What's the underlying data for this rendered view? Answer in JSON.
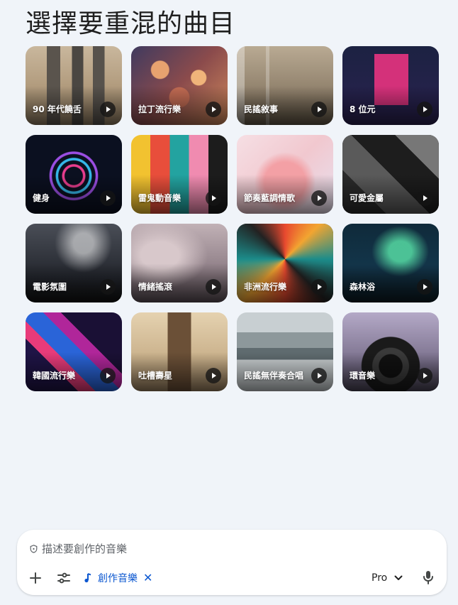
{
  "page": {
    "title": "選擇要重混的曲目"
  },
  "tiles": [
    {
      "label": "90 年代饒舌",
      "bg": "bg-0"
    },
    {
      "label": "拉丁流行樂",
      "bg": "bg-1"
    },
    {
      "label": "民謠敘事",
      "bg": "bg-2"
    },
    {
      "label": "8 位元",
      "bg": "bg-3"
    },
    {
      "label": "健身",
      "bg": "bg-4"
    },
    {
      "label": "雷鬼動音樂",
      "bg": "bg-5"
    },
    {
      "label": "節奏藍調情歌",
      "bg": "bg-6"
    },
    {
      "label": "可愛金屬",
      "bg": "bg-7"
    },
    {
      "label": "電影氛圍",
      "bg": "bg-8"
    },
    {
      "label": "情緒搖滾",
      "bg": "bg-9"
    },
    {
      "label": "非洲流行樂",
      "bg": "bg-10"
    },
    {
      "label": "森林浴",
      "bg": "bg-11"
    },
    {
      "label": "韓國流行樂",
      "bg": "bg-12"
    },
    {
      "label": "吐槽壽星",
      "bg": "bg-13"
    },
    {
      "label": "民謠無伴奏合唱",
      "bg": "bg-14"
    },
    {
      "label": "環音樂",
      "bg": "bg-15"
    }
  ],
  "composer": {
    "placeholder": "描述要創作的音樂",
    "chip_label": "創作音樂",
    "model": "Pro",
    "icons": [
      "shield-icon",
      "plus-icon",
      "tune-icon",
      "music-note-icon",
      "close-icon",
      "chevron-down-icon",
      "mic-icon"
    ]
  }
}
